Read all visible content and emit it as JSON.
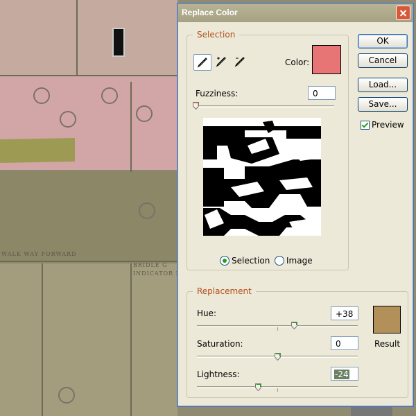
{
  "background": {
    "stencil_top": "WALK WAY FORWARD",
    "stencil_right_1": "BRIDLE G",
    "stencil_right_2": "INDICATOR PL"
  },
  "dialog": {
    "title": "Replace Color",
    "buttons": {
      "ok": "OK",
      "cancel": "Cancel",
      "load": "Load...",
      "save": "Save..."
    },
    "preview": {
      "label": "Preview",
      "checked": true
    },
    "selection": {
      "group_label": "Selection",
      "color_label": "Color:",
      "color": "#e87575",
      "tools": [
        "eyedropper-icon",
        "eyedropper-plus-icon",
        "eyedropper-minus-icon"
      ],
      "fuzziness_label": "Fuzziness:",
      "fuzziness_value": "0",
      "fuzziness_fraction": 0.0,
      "view_modes": [
        {
          "label": "Selection",
          "selected": true
        },
        {
          "label": "Image",
          "selected": false
        }
      ]
    },
    "replacement": {
      "group_label": "Replacement",
      "hue_label": "Hue:",
      "hue_value": "+38",
      "saturation_label": "Saturation:",
      "saturation_value": "0",
      "lightness_label": "Lightness:",
      "lightness_value": "-24",
      "result_label": "Result",
      "result_color": "#b38f5a"
    }
  },
  "colors": {
    "accent_label": "#b34f1c",
    "selection_color": "#e87575",
    "result_color": "#b38f5a",
    "dialog_face": "#ece9d8"
  }
}
